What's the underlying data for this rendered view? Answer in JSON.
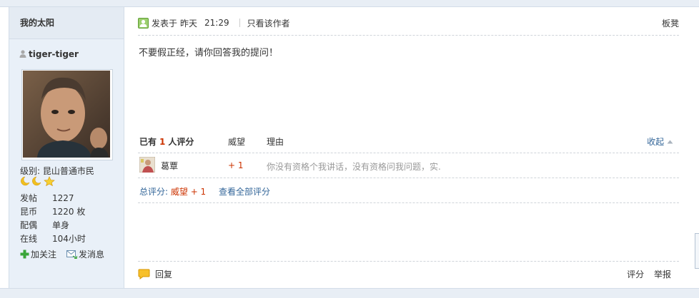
{
  "author": {
    "header_name": "我的太阳",
    "username": "tiger-tiger",
    "level_label": "级别:",
    "level_value": "昆山普通市民",
    "stats": [
      {
        "key": "发帖",
        "value": "1227"
      },
      {
        "key": "昆币",
        "value": "1220 枚"
      },
      {
        "key": "配偶",
        "value": "单身"
      },
      {
        "key": "在线",
        "value": "104小时"
      }
    ],
    "follow_label": "加关注",
    "message_label": "发消息"
  },
  "post": {
    "posted_label": "发表于",
    "posted_day": "昨天",
    "posted_time": "21:29",
    "only_author_label": "只看该作者",
    "floor_label": "板凳",
    "content": "不要假正经，请你回答我的提问！"
  },
  "rating": {
    "header_prefix": "已有",
    "count": "1",
    "header_suffix": "人评分",
    "col_prestige": "威望",
    "col_reason": "理由",
    "collapse_label": "收起",
    "rows": [
      {
        "user": "葛覃",
        "points": "+ 1",
        "reason": "你没有资格个我讲话，没有资格问我问题，实."
      }
    ],
    "total_label": "总评分:",
    "total_value": "威望 + 1",
    "view_all_label": "查看全部评分"
  },
  "footer": {
    "reply_label": "回复",
    "rate_label": "评分",
    "report_label": "举报"
  },
  "colors": {
    "accent_red": "#cc3300",
    "link_blue": "#336699",
    "sidebar_bg": "#e9f0f8"
  }
}
